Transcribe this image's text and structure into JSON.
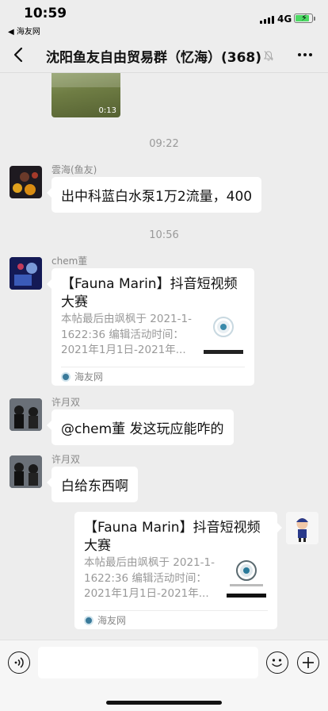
{
  "status_bar": {
    "time": "10:59",
    "back_app": "◀ 海友网",
    "network": "4G",
    "battery_level": 0.85
  },
  "nav": {
    "title": "沈阳鱼友自由贸易群（忆海）(368)",
    "icons": [
      "back-chevron-icon",
      "mute-bell-icon",
      "more-icon"
    ]
  },
  "chat": {
    "video_duration": "0:13",
    "timestamps": [
      "09:22",
      "10:56"
    ],
    "messages": [
      {
        "sender": "雲海(鱼友)",
        "text": "出中科蓝白水泵1万2流量，400"
      },
      {
        "sender": "chem董",
        "card": {
          "title": "【Fauna Marin】抖音短视频大赛",
          "desc": "本帖最后由飒枫于 2021-1-1622:36 编辑活动时间：2021年1月1日-2021年...",
          "source": "海友网"
        }
      },
      {
        "sender": "许月双",
        "text": "@chem董 发这玩应能咋的"
      },
      {
        "sender": "许月双",
        "text": "白给东西啊"
      },
      {
        "sender": "",
        "card": {
          "title": "【Fauna Marin】抖音短视频大赛",
          "desc": "本帖最后由飒枫于 2021-1-1622:36 编辑活动时间：2021年1月1日-2021年...",
          "source": "海友网"
        }
      }
    ]
  },
  "input_bar": {
    "icons": [
      "voice-icon",
      "emoji-icon",
      "plus-icon"
    ]
  },
  "colors": {
    "background": "#ededed",
    "bubble": "#ffffff",
    "secondary_text": "#999999"
  }
}
